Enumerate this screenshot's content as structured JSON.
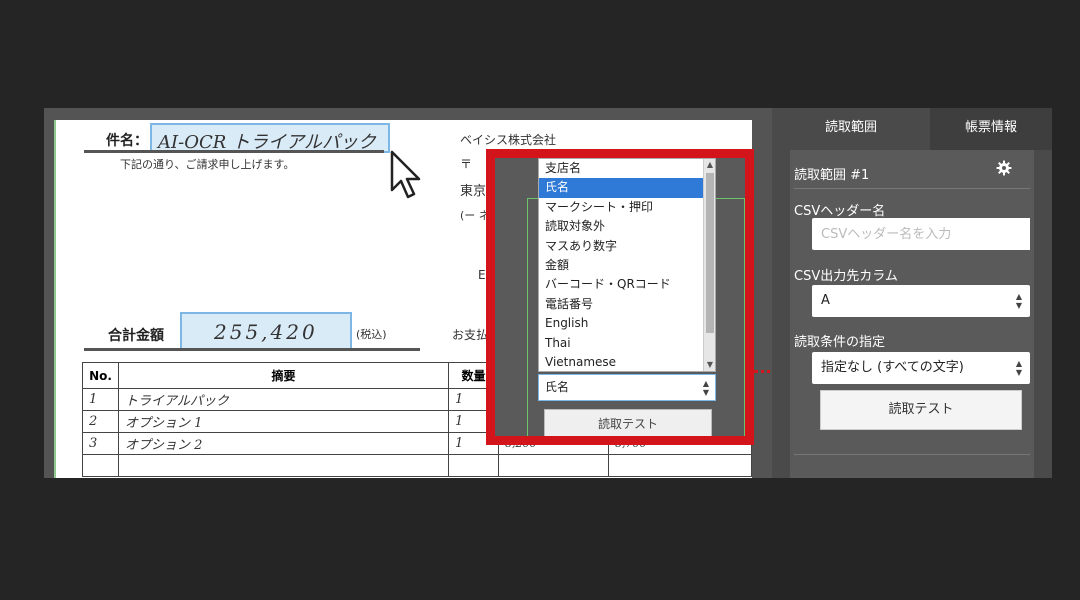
{
  "document": {
    "subject_label": "件名：",
    "subject_value": "AI-OCR トライアルパック",
    "note": "下記の通り、ご請求申し上げます。",
    "company": "ベイシス株式会社",
    "addr_line1": "〒",
    "addr_line2": "東京",
    "addr_line3": "(ー ネ",
    "e_line": "E",
    "total_label": "合計金額",
    "total_value": "255,420",
    "tax_note": "(税込)",
    "payment": "お支払",
    "table": {
      "headers": [
        "No.",
        "摘要",
        "数量"
      ],
      "rows": [
        [
          "1",
          "トライアルパック",
          "1"
        ],
        [
          "2",
          "オプション 1",
          "1"
        ],
        [
          "3",
          "オプション 2",
          "1"
        ]
      ],
      "trailing_values": [
        "8,200",
        "8,700"
      ]
    }
  },
  "dropdown": {
    "options": [
      "支店名",
      "氏名",
      "マークシート・押印",
      "読取対象外",
      "マスあり数字",
      "金額",
      "バーコード・QRコード",
      "電話番号",
      "English",
      "Thai",
      "Vietnamese"
    ],
    "selected_index": 1,
    "select_value": "氏名",
    "test_button": "読取テスト"
  },
  "panel": {
    "tabs": [
      "読取範囲",
      "帳票情報"
    ],
    "region_title": "読取範囲 #1",
    "csv_header_label": "CSVヘッダー名",
    "csv_header_placeholder": "CSVヘッダー名を入力",
    "csv_column_label": "CSV出力先カラム",
    "csv_column_value": "A",
    "condition_label": "読取条件の指定",
    "condition_value": "指定なし (すべての文字)",
    "test_button": "読取テスト"
  }
}
